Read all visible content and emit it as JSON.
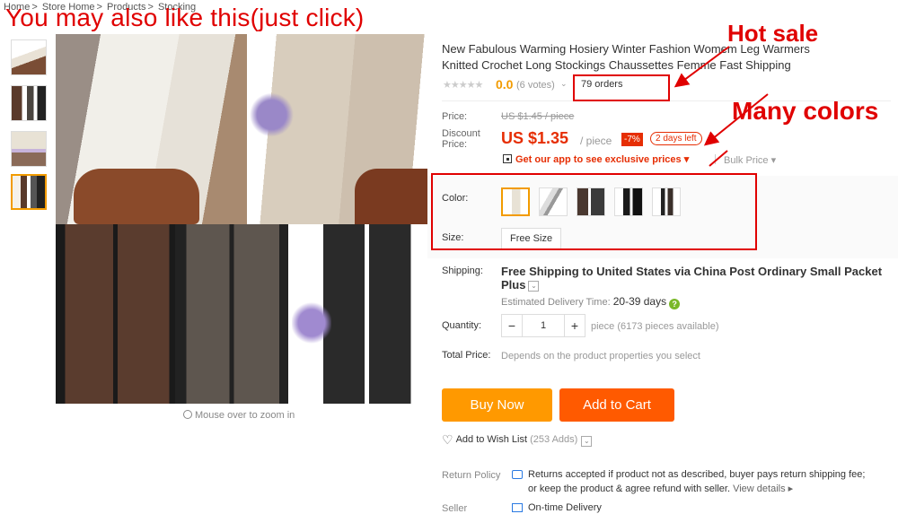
{
  "breadcrumb": [
    "Home",
    ">",
    "Store Home",
    ">",
    "Products",
    ">",
    "Stocking"
  ],
  "annotations": {
    "banner": "You may also like this(just click)",
    "hot_sale": "Hot sale",
    "many_colors": "Many colors",
    "color": "#e00000"
  },
  "gallery": {
    "thumbnail_count": 4,
    "selected_thumbnail": 4,
    "zoom_hint": "Mouse over to zoom in"
  },
  "product": {
    "title": "New Fabulous Warming Hosiery Winter Fashion Womem Leg Warmers Knitted Crochet Long Stockings Chaussettes Femme Fast Shipping",
    "rating": "0.0",
    "votes": "(6 votes)",
    "orders": "79 orders"
  },
  "pricing": {
    "price_label": "Price:",
    "original_price": "US $1.45 / piece",
    "discount_label": "Discount Price:",
    "discount_price": "US $1.35",
    "unit": "/ piece",
    "discount_badge": "-7%",
    "time_left": "2 days left",
    "app_promo": "Get our app to see exclusive prices",
    "bulk_price": "Bulk Price",
    "accent_color": "#e62e04"
  },
  "properties": {
    "color_label": "Color:",
    "color_swatch_count": 5,
    "selected_swatch": 1,
    "size_label": "Size:",
    "size_value": "Free Size"
  },
  "shipping": {
    "label": "Shipping:",
    "method": "Free Shipping to United States via China Post Ordinary Small Packet Plus",
    "estimated_label": "Estimated Delivery Time:",
    "estimated_value": "20-39 days"
  },
  "quantity": {
    "label": "Quantity:",
    "value": "1",
    "minus": "−",
    "plus": "+",
    "available": "piece (6173 pieces available)"
  },
  "total": {
    "label": "Total Price:",
    "value": "Depends on the product properties you select"
  },
  "actions": {
    "buy_now": "Buy Now",
    "add_to_cart": "Add to Cart",
    "buy_color": "#ff9900",
    "cart_color": "#ff5a00"
  },
  "wishlist": {
    "label": "Add to Wish List",
    "count": "(253 Adds)"
  },
  "return_policy": {
    "label": "Return Policy",
    "line1": "Returns accepted if product not as described, buyer pays return shipping fee;",
    "line2": "or keep the product & agree refund with seller.",
    "view_details": "View details ▸"
  },
  "seller": {
    "label": "Seller",
    "guarantee": "On-time Delivery"
  }
}
